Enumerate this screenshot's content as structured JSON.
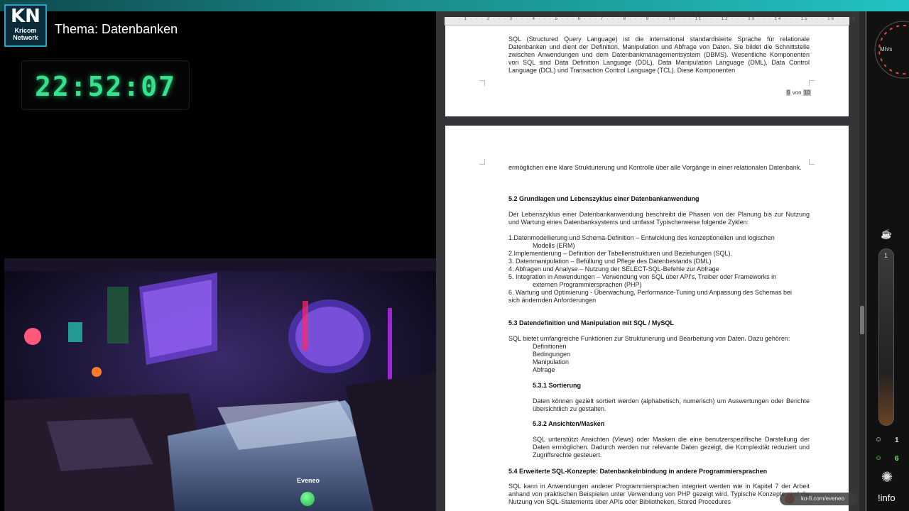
{
  "branding": {
    "logo_text": "KN",
    "logo_sub_line1": "Kricom",
    "logo_sub_line2": "Network"
  },
  "topic": "Thema: Datenbanken",
  "clock": "22:52:07",
  "streamer": "Eveneo",
  "kofi": "ko-fi.com/eveneo",
  "side_panel": {
    "speed_unit": "Mh/s",
    "tube_level": "1",
    "viewer_count_1": "1",
    "viewer_count_2": "6",
    "info_label": "!info"
  },
  "ruler": "· 1 · · · 2 · · · 3 · · · 4 · · · 5 · · · 6 · · · 7 · · · 8 · · · 9 · · · 10 · · · 11 · · · 12 · · · 13 · · · 14 · · · 15 · · · 16 · · 18",
  "page1": {
    "paragraph": "SQL (Structured Query Language) ist die international standardisierte Sprache für relationale Datenbanken und dient der Definition, Manipulation und Abfrage von Daten. Sie bildet die Schnittstelle zwischen Anwendungen und dem Datenbankmanagementsystem (DBMS). Wesentliche Komponenten von SQL sind Data Definition Language (DDL), Data Manipulation Language (DML), Data Control Language (DCL) und Transaction Control Language (TCL). Diese Komponenten",
    "page_current": "6",
    "page_von": "von",
    "page_total": "10"
  },
  "page2": {
    "cont": "ermöglichen eine klare Strukturierung und Kontrolle über alle Vorgänge in einer relationalen Datenbank.",
    "h52": "5.2 Grundlagen und Lebenszyklus einer Datenbankanwendung",
    "p52": "Der Lebenszyklus einer Datenbankanwendung beschreibt die Phasen von der Planung bis zur Nutzung und Wartung eines Datenbanksystems und umfasst Typischerweise folgende Zyklen:",
    "list": [
      "1.Datenmodellierung und Schema-Definition – Entwicklung des konzeptionellen und logischen",
      "Modells (ERM)",
      "2.Implementierung – Definition der Tabellenstrukturen und Beziehungen (SQL).",
      "3. Datenmanipulation – Befüllung und Pflege des Datenbestands (DML)",
      "4. Abfragen und Analyse – Nutzung der SELECT-SQL-Befehle zur Abfrage",
      "5. Integration in Anwendungen – Verwendung von SQL über API's, Treiber oder Frameworks in",
      "externen Programmiersprachen (PHP)",
      "6. Wartung und Optimierung - Überwachung, Performance-Tuning und Anpassung des Schemas bei",
      "sich ändernden Anforderungen"
    ],
    "h53": "5.3 Datendefinition und Manipulation mit SQL / MySQL",
    "p53": "SQL bietet umfangreiche Funktionen zur Strukturierung und Bearbeitung von Daten. Dazu gehören:",
    "sub_list": [
      "Definitionen",
      "Bedingungen",
      "Manipulation",
      "Abfrage"
    ],
    "h531": "5.3.1 Sortierung",
    "p531": "Daten können gezielt sortiert werden (alphabetisch, numerisch) um Auswertungen oder Berichte übersichtlich zu gestalten.",
    "h532": "5.3.2 Ansichten/Masken",
    "p532": "SQL unterstützt Ansichten (Views) oder Masken die eine benutzerspezifische Darstellung der Daten ermöglichen. Dadurch werden nur relevante Daten gezeigt, die Komplexität reduziert und Zugriffsrechte gesteuert.",
    "h54": "5.4 Erweiterte SQL-Konzepte: Datenbankeinbindung in andere Programmiersprachen",
    "p54": "SQL kann in Anwendungen anderer Programmiersprachen integriert werden wie in Kapitel 7 der Arbeit anhand von praktischen Beispielen unter Verwendung von PHP gezeigt wird. Typische Konzepte sind die Nutzung von SQL-Statements über APIs oder Bibliotheken, Stored Procedures"
  }
}
